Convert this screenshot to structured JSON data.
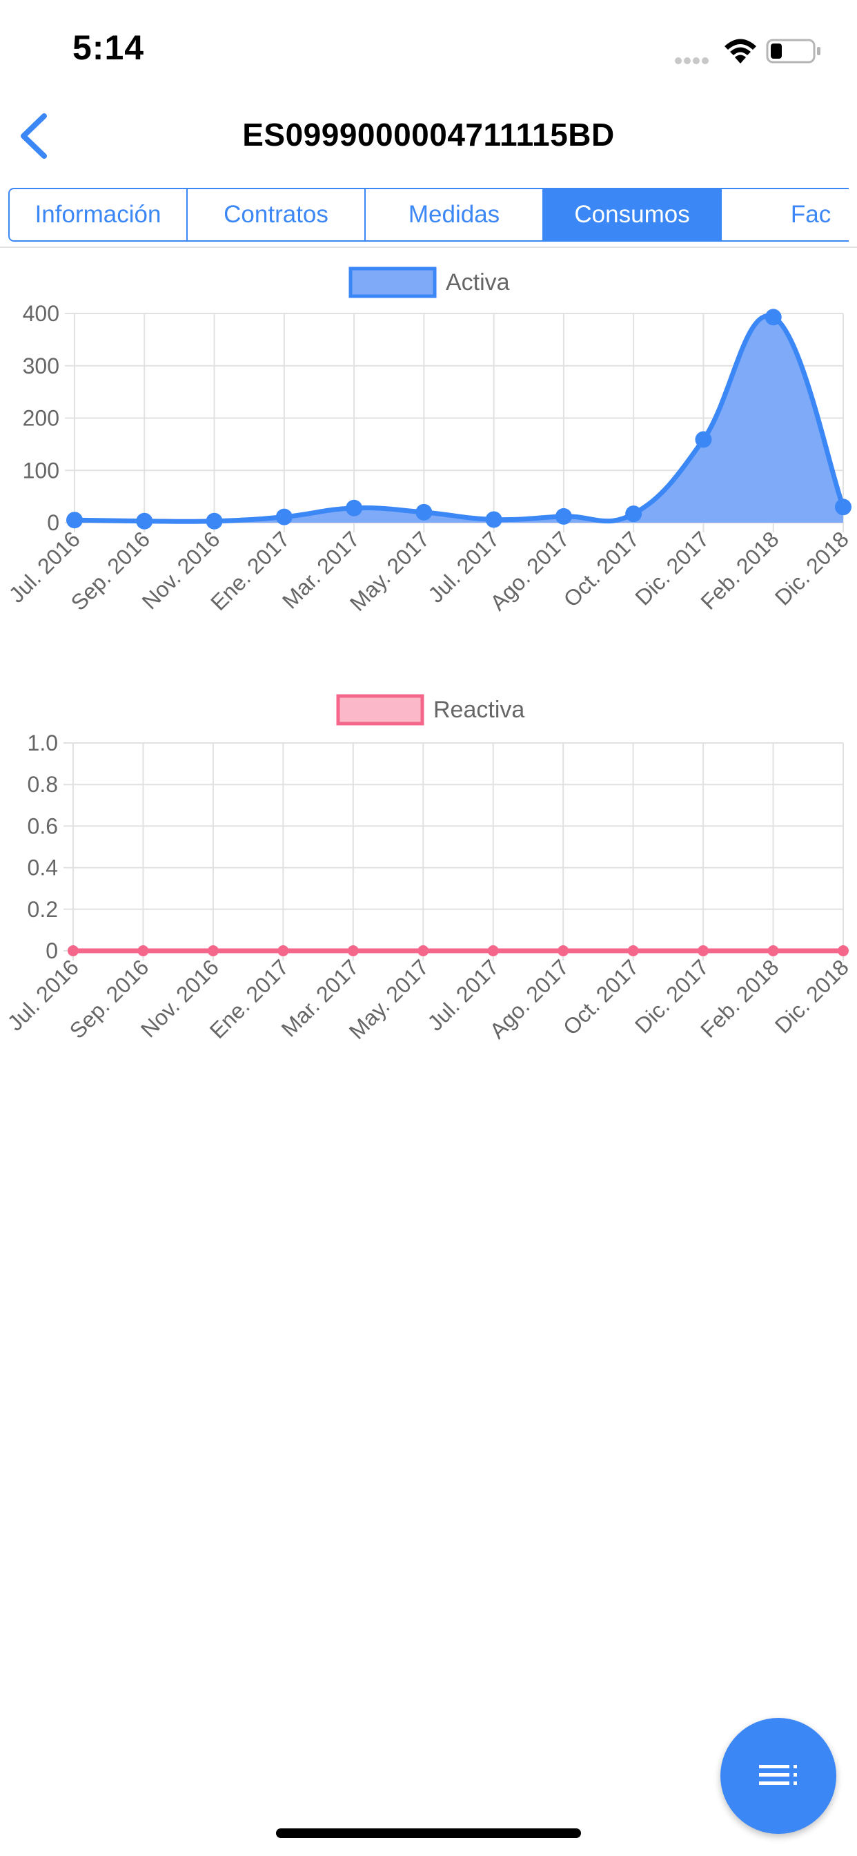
{
  "status_bar": {
    "time": "5:14"
  },
  "nav": {
    "title": "ES0999000004711115BD",
    "back_icon": "chevron-left-icon"
  },
  "tabs": [
    {
      "label": "Información",
      "active": false
    },
    {
      "label": "Contratos",
      "active": false
    },
    {
      "label": "Medidas",
      "active": false
    },
    {
      "label": "Consumos",
      "active": true
    },
    {
      "label": "Fac",
      "active": false
    }
  ],
  "colors": {
    "accent": "#3c87f6",
    "active_fill": "#7faaf7",
    "reactive_line": "#f4678a",
    "reactive_fill": "#fbb8c8",
    "grid": "#e1e1e1",
    "axis_text": "#666666"
  },
  "chart_data": [
    {
      "type": "area",
      "legend": [
        "Activa"
      ],
      "legend_position": "top-center",
      "grid": true,
      "x": [
        "Jul. 2016",
        "Sep. 2016",
        "Nov. 2016",
        "Ene. 2017",
        "Mar. 2017",
        "May. 2017",
        "Jul. 2017",
        "Ago. 2017",
        "Oct. 2017",
        "Dic. 2017",
        "Feb. 2018",
        "Dic. 2018"
      ],
      "series": [
        {
          "name": "Activa",
          "values": [
            5,
            3,
            3,
            11,
            28,
            20,
            6,
            12,
            17,
            159,
            393,
            30
          ]
        }
      ],
      "yticks": [
        "0",
        "100",
        "200",
        "300",
        "400"
      ],
      "ylim": [
        0,
        400
      ]
    },
    {
      "type": "line",
      "legend": [
        "Reactiva"
      ],
      "legend_position": "top-center",
      "grid": true,
      "x": [
        "Jul. 2016",
        "Sep. 2016",
        "Nov. 2016",
        "Ene. 2017",
        "Mar. 2017",
        "May. 2017",
        "Jul. 2017",
        "Ago. 2017",
        "Oct. 2017",
        "Dic. 2017",
        "Feb. 2018",
        "Dic. 2018"
      ],
      "series": [
        {
          "name": "Reactiva",
          "values": [
            0,
            0,
            0,
            0,
            0,
            0,
            0,
            0,
            0,
            0,
            0,
            0
          ]
        }
      ],
      "yticks": [
        "0",
        "0.2",
        "0.4",
        "0.6",
        "0.8",
        "1.0"
      ],
      "ylim": [
        0,
        1
      ]
    }
  ],
  "fab": {
    "icon": "list-menu-icon"
  }
}
